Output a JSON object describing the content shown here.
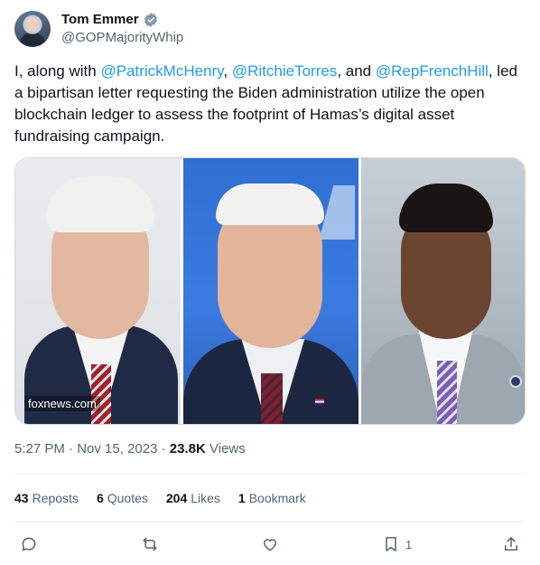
{
  "author": {
    "name": "Tom Emmer",
    "handle": "@GOPMajorityWhip",
    "verified_icon": "verified-badge-icon"
  },
  "tweet": {
    "text_1": "I, along with ",
    "mention_1": "@PatrickMcHenry",
    "text_2": ", ",
    "mention_2": "@RitchieTorres",
    "text_3": ", and ",
    "mention_3": "@RepFrenchHill",
    "text_4": ", led a bipartisan letter requesting the Biden administration utilize the open blockchain ledger to assess the footprint of Hamas’s digital asset fundraising campaign."
  },
  "media": {
    "watermark": "foxnews.com"
  },
  "meta": {
    "time": "5:27 PM",
    "date": "Nov 15, 2023",
    "separator": "·",
    "views_count": "23.8K",
    "views_label": "Views"
  },
  "stats": {
    "reposts_count": "43",
    "reposts_label": "Reposts",
    "quotes_count": "6",
    "quotes_label": "Quotes",
    "likes_count": "204",
    "likes_label": "Likes",
    "bookmarks_count": "1",
    "bookmarks_label": "Bookmark"
  },
  "actions": {
    "bookmark_count": "1"
  },
  "colors": {
    "accent": "#1d9bf0",
    "secondary_text": "#536471"
  }
}
